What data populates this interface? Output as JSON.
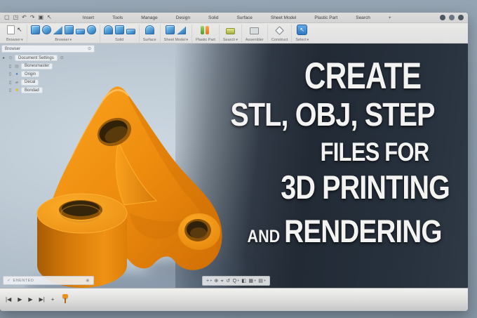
{
  "ui": {
    "caret": "▾",
    "cursor": "↖"
  },
  "menu": {
    "icons": [
      "▢",
      "◳",
      "↶",
      "↷",
      "▣",
      "↖"
    ],
    "items": [
      "Insert",
      "Tools",
      "Manage",
      "Design",
      "Solid",
      "Surface",
      "Sheet Model",
      "Plastic Part",
      "Search",
      "+"
    ]
  },
  "toolbar": {
    "groups": [
      {
        "label": "Browser"
      },
      {
        "label": "Browser"
      },
      {
        "label": "Solid"
      },
      {
        "label": "Surface"
      },
      {
        "label": "Sheet Model"
      },
      {
        "label": "Plastic Part"
      },
      {
        "label": "Search"
      },
      {
        "label": "Assembler"
      },
      {
        "label": "Construct"
      },
      {
        "label": "Select"
      }
    ]
  },
  "browser": {
    "header": "Browser",
    "rows": [
      {
        "lead": "▸",
        "icon": "⊙",
        "label": "Document Settings",
        "trail": "⊙"
      },
      {
        "lead": "▯",
        "icon": "▤",
        "label": "Bonesmaster"
      },
      {
        "lead": "▯",
        "icon": "●",
        "label": "Origin"
      },
      {
        "lead": "▯",
        "icon": "▰",
        "label": "Decal"
      },
      {
        "lead": "▯",
        "icon": "■",
        "label": "Bondad"
      }
    ]
  },
  "status": {
    "check": "✓",
    "text": "ENENTED",
    "trail": "◉"
  },
  "nav": {
    "icons": [
      "+",
      "⊕",
      "⌖",
      "↺",
      "Q",
      "◧",
      "▦",
      "▤"
    ]
  },
  "timeline": {
    "icons": [
      "|◀",
      "▶",
      "▶",
      "▶|",
      "+"
    ]
  },
  "overlay": {
    "l1": "CREATE",
    "l2": "STL, OBJ, STEP",
    "l3": "FILES FOR",
    "l4": "3D PRINTING",
    "l5a": "AND",
    "l5b": "RENDERING"
  },
  "colors": {
    "accent_orange": "#ef8a0e",
    "panel_dark": "#222c38",
    "canvas_blue": "#b9c6d2",
    "toolbar_icon_blue": "#4a90d9"
  }
}
